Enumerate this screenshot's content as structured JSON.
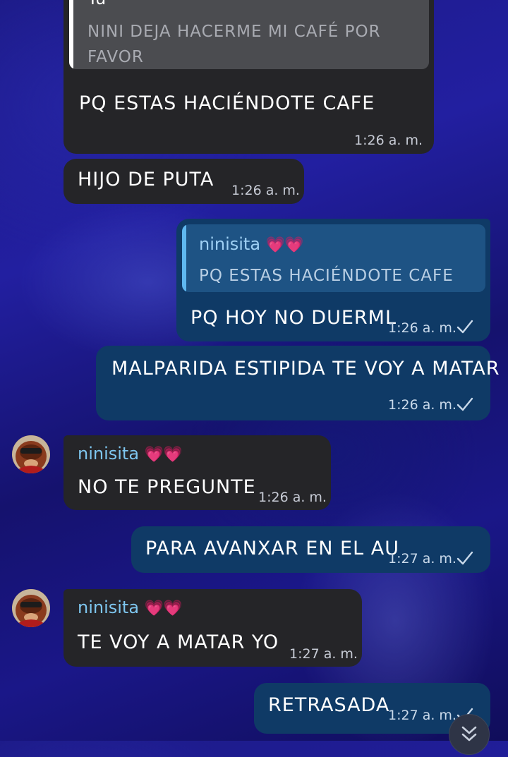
{
  "messages": {
    "m1": {
      "reply_sender": "Tú",
      "reply_text_line1": "NINI DEJA HACERME MI CAFÉ POR",
      "reply_text_line2": "FAVOR",
      "text": "PQ ESTAS HACIÉNDOTE CAFE",
      "time": "1:26 a. m."
    },
    "m2": {
      "text": "HIJO DE PUTA",
      "time": "1:26 a. m."
    },
    "m3": {
      "reply_sender": "ninisita",
      "reply_hearts": "💗💗",
      "reply_text": "PQ ESTAS HACIÉNDOTE CAFE",
      "text": "PQ HOY NO DUERML",
      "time": "1:26 a. m."
    },
    "m4": {
      "text": "MALPARIDA ESTIPIDA TE VOY A MATAR",
      "time": "1:26 a. m."
    },
    "m5": {
      "sender": "ninisita",
      "hearts": "💗💗",
      "text": "NO TE PREGUNTE",
      "time": "1:26 a. m."
    },
    "m6": {
      "text": "PARA AVANXAR EN EL AU",
      "time": "1:27 a. m."
    },
    "m7": {
      "sender": "ninisita",
      "hearts": "💗💗",
      "text": "TE VOY A MATAR YO",
      "time": "1:27 a. m."
    },
    "m8": {
      "text": "RETRASADA",
      "time": "1:27 a. m."
    }
  },
  "colors": {
    "incoming_bubble": "#252528",
    "outgoing_bubble": "#0f3a66",
    "sender_name": "#7ec6ef",
    "quote_bar_outgoing": "#5fb8f0",
    "quote_bar_incoming": "#ffffff"
  },
  "icons": {
    "read_check": "check-icon",
    "scroll_down": "double-chevron-down-icon",
    "avatar": "avatar"
  }
}
